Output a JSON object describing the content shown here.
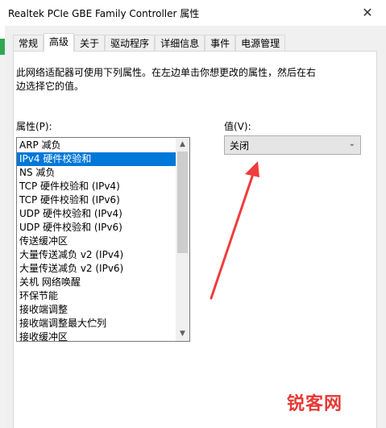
{
  "window": {
    "title": "Realtek PCIe GBE Family Controller 属性",
    "close_glyph": "✕"
  },
  "tabs": [
    {
      "label": "常规",
      "active": false
    },
    {
      "label": "高级",
      "active": true
    },
    {
      "label": "关于",
      "active": false
    },
    {
      "label": "驱动程序",
      "active": false
    },
    {
      "label": "详细信息",
      "active": false
    },
    {
      "label": "事件",
      "active": false
    },
    {
      "label": "电源管理",
      "active": false
    }
  ],
  "advanced": {
    "description_line1": "此网络适配器可使用下列属性。在左边单击你想更改的属性，然后在右",
    "description_line2": "边选择它的值。",
    "property_label": "属性(P):",
    "value_label": "值(V):",
    "properties": [
      "ARP 减负",
      "IPv4 硬件校验和",
      "NS 减负",
      "TCP 硬件校验和 (IPv4)",
      "TCP 硬件校验和 (IPv6)",
      "UDP 硬件校验和 (IPv4)",
      "UDP 硬件校验和 (IPv6)",
      "传送缓冲区",
      "大量传送减负 v2 (IPv4)",
      "大量传送减负 v2 (IPv6)",
      "关机 网络唤醒",
      "环保节能",
      "接收端调整",
      "接收端调整最大伫列",
      "接收缓冲区"
    ],
    "selected_index": 1,
    "value_selected": "关闭"
  },
  "icons": {
    "scroll_up": "▲",
    "scroll_down": "▼",
    "chevron": "⌄"
  },
  "annotation": {
    "color": "#f03c3c"
  },
  "watermark": "锐客网"
}
